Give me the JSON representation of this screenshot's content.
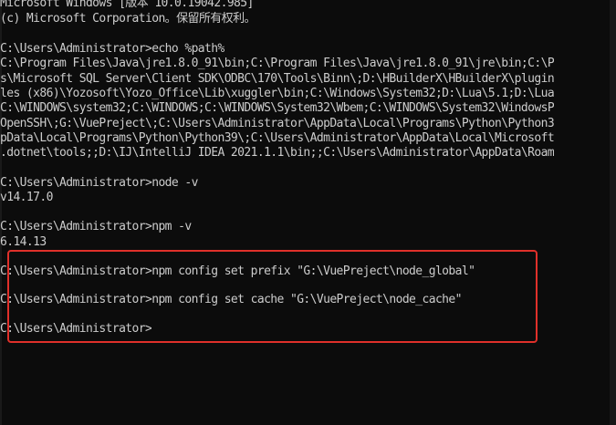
{
  "console": {
    "lines": [
      "Microsoft Windows [版本 10.0.19042.985]",
      "(c) Microsoft Corporation。保留所有权利。",
      "C:\\Users\\Administrator>echo %path%",
      "C:\\Program Files\\Java\\jre1.8.0_91\\bin;C:\\Program Files\\Java\\jre1.8.0_91\\jre\\bin;C:\\P",
      "s\\Microsoft SQL Server\\Client SDK\\ODBC\\170\\Tools\\Binn\\;D:\\HBuilderX\\HBuilderX\\plugin",
      "les (x86)\\Yozosoft\\Yozo_Office\\Lib\\xuggler\\bin;C:\\Windows\\System32;D:\\Lua\\5.1;D:\\Lua",
      "C:\\WINDOWS\\system32;C:\\WINDOWS;C:\\WINDOWS\\System32\\Wbem;C:\\WINDOWS\\System32\\WindowsP",
      "OpenSSH\\;G:\\VuePreject\\;C:\\Users\\Administrator\\AppData\\Local\\Programs\\Python\\Python3",
      "pData\\Local\\Programs\\Python\\Python39\\;C:\\Users\\Administrator\\AppData\\Local\\Microsoft",
      ".dotnet\\tools;;D:\\IJ\\IntelliJ IDEA 2021.1.1\\bin;;C:\\Users\\Administrator\\AppData\\Roam",
      "C:\\Users\\Administrator>node -v",
      "v14.17.0",
      "C:\\Users\\Administrator>npm -v",
      "6.14.13",
      "C:\\Users\\Administrator>npm config set prefix \"G:\\VuePreject\\node_global\"",
      "C:\\Users\\Administrator>npm config set cache \"G:\\VuePreject\\node_cache\"",
      "C:\\Users\\Administrator>"
    ]
  },
  "colors": {
    "background": "#0c0c0c",
    "text": "#cccccc",
    "highlight_border": "#e0302a"
  }
}
